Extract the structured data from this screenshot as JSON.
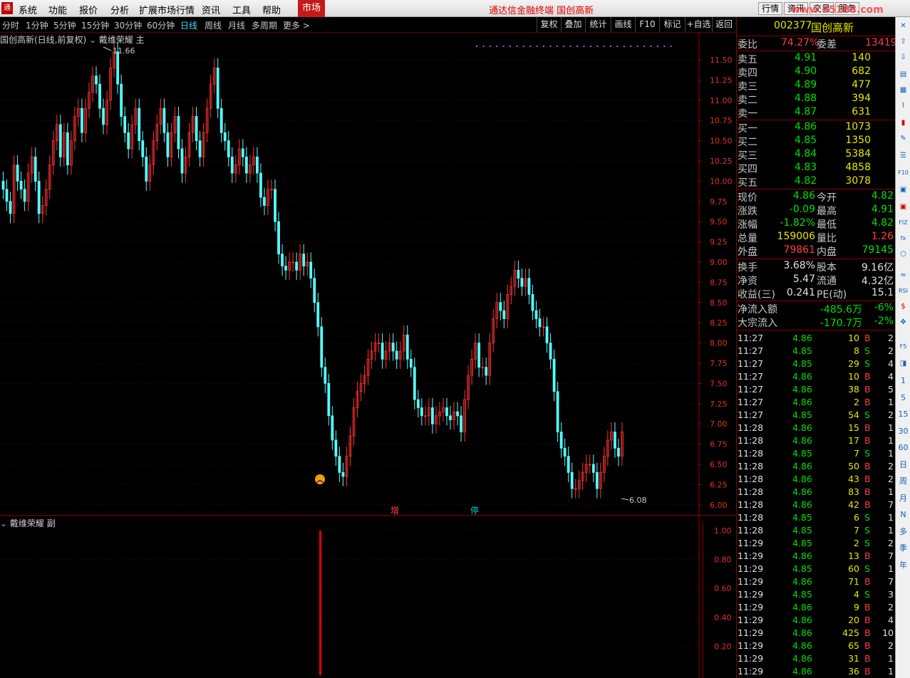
{
  "menu": {
    "logo": "通",
    "items": [
      "系统",
      "功能",
      "报价",
      "分析",
      "扩展市场行情",
      "资讯",
      "工具",
      "帮助"
    ],
    "market_tab": "市场",
    "title": "通达信金融终端  国创高新",
    "buttons": [
      "行情",
      "资讯",
      "交易",
      "服务"
    ],
    "watermark": "www.55188.com"
  },
  "periods": {
    "items": [
      "分时",
      "1分钟",
      "5分钟",
      "15分钟",
      "30分钟",
      "60分钟",
      "日线",
      "周线",
      "月线",
      "多周期",
      "更多 >"
    ],
    "active": "日线"
  },
  "tools": [
    "复权",
    "叠加",
    "统计",
    "画线",
    "F10",
    "标记",
    "+自选",
    "返回"
  ],
  "main_chart": {
    "title": "国创高新(日线,前复权)",
    "indicator": "戴维荣耀 主",
    "high_label": "11.66",
    "low_label": "6.08",
    "y_ticks": [
      "11.50",
      "11.25",
      "11.00",
      "10.75",
      "10.50",
      "10.25",
      "10.00",
      "9.75",
      "9.50",
      "9.25",
      "9.00",
      "8.75",
      "8.50",
      "8.25",
      "8.00",
      "7.75",
      "7.50",
      "7.25",
      "7.00",
      "6.75",
      "6.50",
      "6.25",
      "6.00"
    ],
    "marker_zeng": "增",
    "marker_ting": "停"
  },
  "sub_chart": {
    "title": "戴维荣耀 副",
    "y_ticks": [
      "1.00",
      "0.80",
      "0.60",
      "0.40",
      "0.20"
    ]
  },
  "quote": {
    "code": "002377",
    "name": "国创高新",
    "weibi_label": "委比",
    "weibi": "74.27%",
    "weicha_label": "委差",
    "weicha": "13419",
    "asks": [
      {
        "label": "卖五",
        "price": "4.91",
        "vol": "140"
      },
      {
        "label": "卖四",
        "price": "4.90",
        "vol": "682"
      },
      {
        "label": "卖三",
        "price": "4.89",
        "vol": "477"
      },
      {
        "label": "卖二",
        "price": "4.88",
        "vol": "394"
      },
      {
        "label": "卖一",
        "price": "4.87",
        "vol": "631"
      }
    ],
    "bids": [
      {
        "label": "买一",
        "price": "4.86",
        "vol": "1073"
      },
      {
        "label": "买二",
        "price": "4.85",
        "vol": "1350"
      },
      {
        "label": "买三",
        "price": "4.84",
        "vol": "5384"
      },
      {
        "label": "买四",
        "price": "4.83",
        "vol": "4858"
      },
      {
        "label": "买五",
        "price": "4.82",
        "vol": "3078"
      }
    ],
    "stats": [
      {
        "l1": "现价",
        "v1": "4.86",
        "c1": "green",
        "l2": "今开",
        "v2": "4.82",
        "c2": "green"
      },
      {
        "l1": "涨跌",
        "v1": "-0.09",
        "c1": "green",
        "l2": "最高",
        "v2": "4.91",
        "c2": "green"
      },
      {
        "l1": "涨幅",
        "v1": "-1.82%",
        "c1": "green",
        "l2": "最低",
        "v2": "4.82",
        "c2": "green"
      },
      {
        "l1": "总量",
        "v1": "159006",
        "c1": "yellow",
        "l2": "量比",
        "v2": "1.26",
        "c2": "red"
      },
      {
        "l1": "外盘",
        "v1": "79861",
        "c1": "red",
        "l2": "内盘",
        "v2": "79145",
        "c2": "green"
      }
    ],
    "stats2": [
      {
        "l1": "换手",
        "v1": "3.68%",
        "l2": "股本",
        "v2": "9.16亿"
      },
      {
        "l1": "净资",
        "v1": "5.47",
        "l2": "流通",
        "v2": "4.32亿"
      },
      {
        "l1": "收益(三)",
        "v1": "0.241",
        "l2": "PE(动)",
        "v2": "15.1"
      }
    ],
    "flows": [
      {
        "label": "净流入额",
        "value": "-485.6万",
        "pct": "-6%"
      },
      {
        "label": "大宗流入",
        "value": "-170.7万",
        "pct": "-2%"
      }
    ]
  },
  "ticks": [
    [
      "11:27",
      "4.86",
      "10",
      "B",
      "2"
    ],
    [
      "11:27",
      "4.85",
      "8",
      "S",
      "2"
    ],
    [
      "11:27",
      "4.85",
      "29",
      "S",
      "4"
    ],
    [
      "11:27",
      "4.86",
      "10",
      "B",
      "4"
    ],
    [
      "11:27",
      "4.86",
      "38",
      "B",
      "5"
    ],
    [
      "11:27",
      "4.86",
      "2",
      "B",
      "1"
    ],
    [
      "11:27",
      "4.85",
      "54",
      "S",
      "2"
    ],
    [
      "11:28",
      "4.86",
      "15",
      "B",
      "1"
    ],
    [
      "11:28",
      "4.86",
      "17",
      "B",
      "1"
    ],
    [
      "11:28",
      "4.85",
      "7",
      "S",
      "1"
    ],
    [
      "11:28",
      "4.86",
      "50",
      "B",
      "2"
    ],
    [
      "11:28",
      "4.86",
      "43",
      "B",
      "2"
    ],
    [
      "11:28",
      "4.86",
      "83",
      "B",
      "1"
    ],
    [
      "11:28",
      "4.86",
      "42",
      "B",
      "7"
    ],
    [
      "11:28",
      "4.85",
      "6",
      "S",
      "1"
    ],
    [
      "11:28",
      "4.85",
      "7",
      "S",
      "1"
    ],
    [
      "11:29",
      "4.85",
      "2",
      "S",
      "2"
    ],
    [
      "11:29",
      "4.86",
      "13",
      "B",
      "7"
    ],
    [
      "11:29",
      "4.85",
      "60",
      "S",
      "1"
    ],
    [
      "11:29",
      "4.86",
      "71",
      "B",
      "7"
    ],
    [
      "11:29",
      "4.85",
      "4",
      "S",
      "3"
    ],
    [
      "11:29",
      "4.86",
      "9",
      "B",
      "2"
    ],
    [
      "11:29",
      "4.86",
      "20",
      "B",
      "4"
    ],
    [
      "11:29",
      "4.86",
      "425",
      "B",
      "10"
    ],
    [
      "11:29",
      "4.86",
      "65",
      "B",
      "2"
    ],
    [
      "11:29",
      "4.86",
      "31",
      "B",
      "1"
    ],
    [
      "11:29",
      "4.86",
      "36",
      "B",
      "1"
    ]
  ],
  "side_toolbar": [
    "1",
    "5",
    "15",
    "30",
    "60",
    "日",
    "周",
    "月",
    "N",
    "多",
    "季",
    "年"
  ],
  "chart_data": {
    "type": "candlestick",
    "ylim": [
      6.0,
      11.66
    ],
    "closes": [
      9.9,
      9.75,
      9.6,
      10.2,
      10.0,
      9.9,
      9.75,
      10.1,
      10.3,
      10.0,
      9.6,
      9.7,
      9.9,
      10.2,
      10.5,
      10.7,
      10.3,
      10.6,
      10.2,
      10.5,
      10.8,
      10.9,
      10.6,
      10.9,
      11.1,
      11.3,
      11.2,
      10.9,
      10.7,
      11.0,
      11.4,
      11.6,
      11.2,
      10.8,
      10.6,
      10.4,
      10.7,
      10.9,
      10.5,
      10.3,
      10.0,
      10.2,
      10.5,
      10.7,
      10.9,
      10.6,
      10.3,
      10.6,
      10.8,
      10.4,
      10.1,
      10.3,
      10.6,
      10.8,
      10.5,
      10.3,
      10.6,
      10.9,
      11.2,
      11.4,
      10.9,
      10.6,
      10.5,
      10.3,
      10.1,
      10.2,
      10.4,
      10.3,
      10.1,
      10.2,
      10.3,
      10.1,
      9.8,
      9.7,
      9.9,
      9.9,
      9.5,
      9.1,
      8.95,
      8.9,
      9.0,
      9.0,
      8.9,
      9.1,
      8.95,
      9.0,
      8.8,
      8.5,
      8.2,
      7.7,
      7.5,
      7.1,
      6.8,
      6.6,
      6.4,
      6.35,
      6.6,
      6.85,
      7.2,
      7.4,
      7.5,
      7.6,
      7.8,
      7.9,
      8.0,
      8.0,
      7.8,
      7.9,
      8.0,
      7.9,
      7.8,
      7.9,
      8.1,
      7.8,
      7.7,
      7.3,
      7.2,
      7.1,
      7.1,
      7.2,
      7.0,
      7.1,
      7.15,
      7.2,
      7.1,
      7.05,
      7.15,
      7.1,
      6.9,
      7.3,
      7.6,
      7.8,
      8.0,
      7.7,
      7.7,
      7.6,
      8.0,
      8.3,
      8.5,
      8.4,
      8.3,
      8.6,
      8.7,
      8.9,
      8.8,
      8.7,
      8.8,
      8.6,
      8.4,
      8.3,
      8.2,
      8.2,
      8.0,
      7.8,
      7.4,
      6.9,
      6.7,
      6.6,
      6.4,
      6.2,
      6.2,
      6.3,
      6.4,
      6.5,
      6.5,
      6.4,
      6.2,
      6.4,
      6.6,
      6.8,
      6.9,
      6.7,
      6.6,
      6.9
    ]
  }
}
